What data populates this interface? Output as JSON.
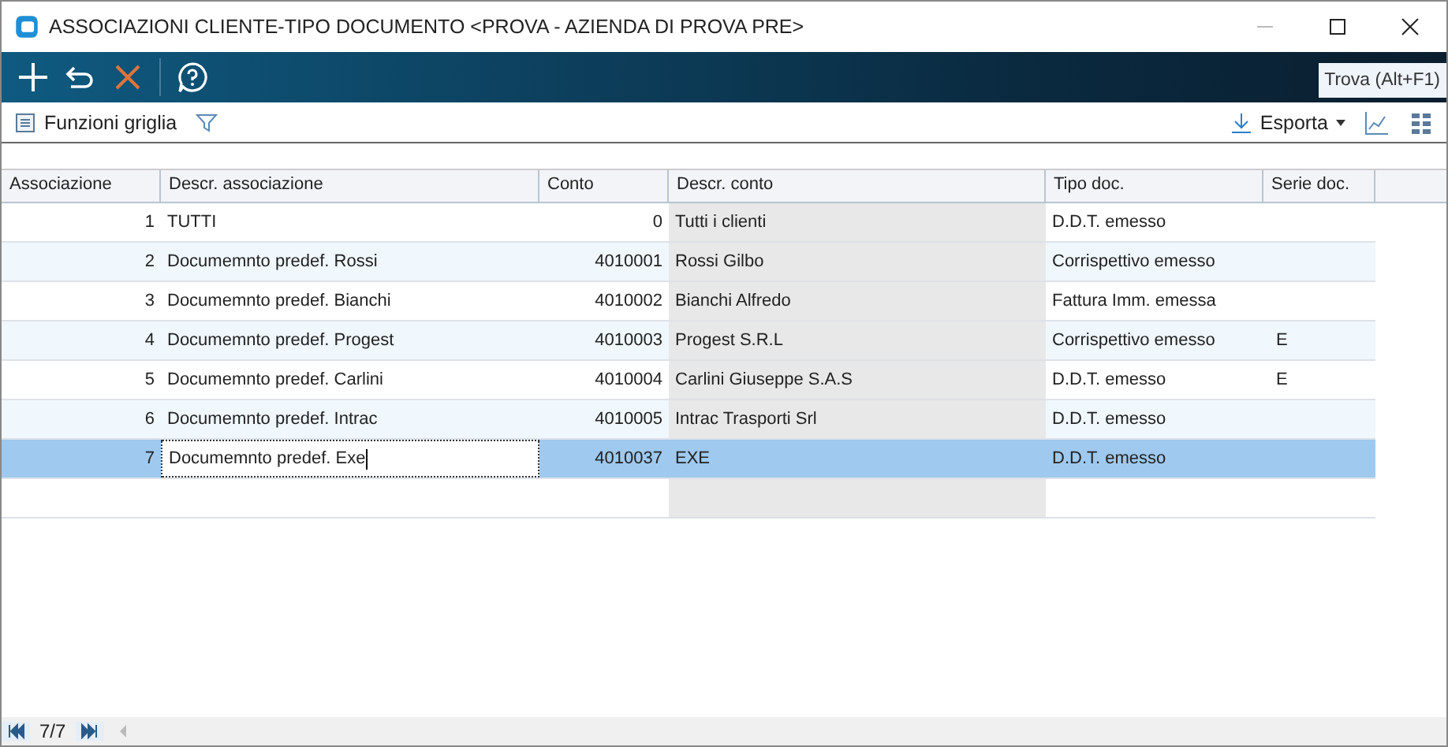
{
  "window": {
    "title": "ASSOCIAZIONI CLIENTE-TIPO DOCUMENTO <PROVA - AZIENDA DI PROVA PRE>"
  },
  "tooltip": "Trova (Alt+F1)",
  "grid_toolbar": {
    "functions_label": "Funzioni griglia",
    "export_label": "Esporta"
  },
  "table": {
    "columns": [
      "Associazione",
      "Descr. associazione",
      "Conto",
      "Descr. conto",
      "Tipo doc.",
      "Serie doc."
    ],
    "rows": [
      {
        "cells": [
          "1",
          "TUTTI",
          "0",
          "Tutti i clienti",
          "D.D.T. emesso",
          ""
        ],
        "selected": false
      },
      {
        "cells": [
          "2",
          "Documemnto predef. Rossi",
          "4010001",
          "Rossi Gilbo",
          "Corrispettivo emesso",
          ""
        ],
        "selected": false
      },
      {
        "cells": [
          "3",
          "Documemnto predef. Bianchi",
          "4010002",
          "Bianchi Alfredo",
          "Fattura Imm. emessa",
          ""
        ],
        "selected": false
      },
      {
        "cells": [
          "4",
          "Documemnto predef. Progest",
          "4010003",
          "Progest S.R.L",
          "Corrispettivo emesso",
          "E"
        ],
        "selected": false
      },
      {
        "cells": [
          "5",
          "Documemnto predef. Carlini",
          "4010004",
          "Carlini Giuseppe S.A.S",
          "D.D.T. emesso",
          "E"
        ],
        "selected": false
      },
      {
        "cells": [
          "6",
          "Documemnto predef. Intrac",
          "4010005",
          "Intrac Trasporti Srl",
          "D.D.T. emesso",
          ""
        ],
        "selected": false
      },
      {
        "cells": [
          "7",
          "Documemnto predef. Exe",
          "4010037",
          "EXE",
          "D.D.T. emesso",
          ""
        ],
        "selected": true
      }
    ]
  },
  "pager": {
    "position": "7/7"
  }
}
